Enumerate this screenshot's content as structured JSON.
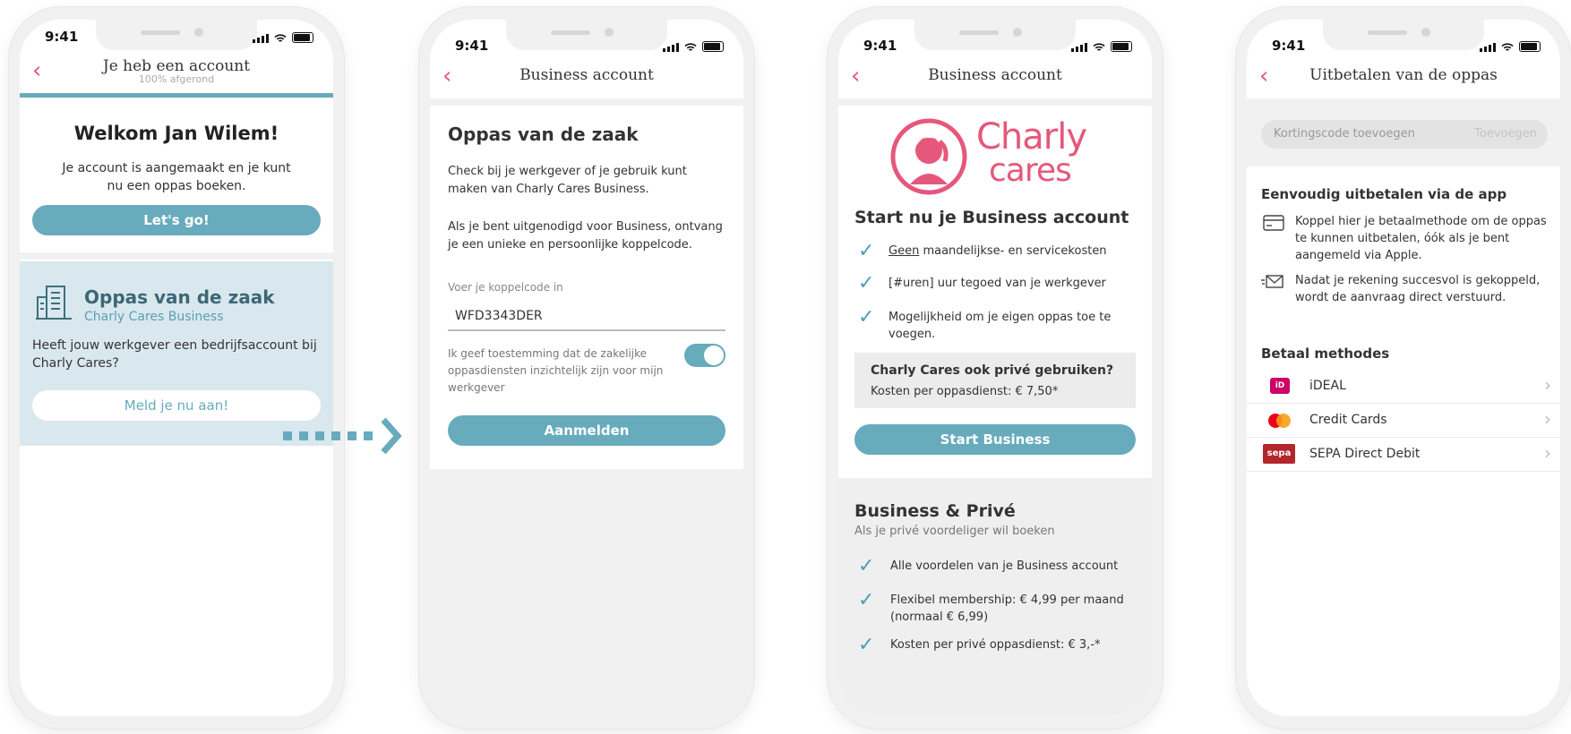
{
  "status_time": "9:41",
  "phone1": {
    "nav_title": "Je heb een account",
    "nav_subtitle": "100% afgerond",
    "welcome_title": "Welkom Jan Wilem!",
    "welcome_text": "Je account is aangemaakt en je kunt nu een oppas boeken.",
    "cta_label": "Let's go!",
    "business_title": "Oppas van de zaak",
    "business_subtitle": "Charly Cares Business",
    "business_text": "Heeft jouw werkgever een bedrijfsaccount bij Charly Cares?",
    "signup_label": "Meld je nu aan!"
  },
  "phone2": {
    "nav_title": "Business account",
    "heading": "Oppas van de zaak",
    "para1": "Check bij je werkgever of je gebruik kunt maken van Charly Cares Business.",
    "para2": "Als je bent uitgenodigd voor Business, ontvang je een unieke en persoonlijke koppelcode.",
    "field_label": "Voer je koppelcode in",
    "field_value": "WFD3343DER",
    "consent_text": "Ik geef toestemming dat de zakelijke oppasdiensten inzichtelijk zijn voor mijn werkgever",
    "toggle_on": true,
    "submit_label": "Aanmelden"
  },
  "phone3": {
    "nav_title": "Business account",
    "logo_line1": "Charly",
    "logo_line2": "cares",
    "start_title": "Start nu je Business account",
    "benefits": [
      {
        "prefix": "Geen",
        "rest": " maandelijkse- en servicekosten"
      },
      {
        "prefix": "",
        "rest": "[#uren] uur tegoed van je werkgever"
      },
      {
        "prefix": "",
        "rest": "Mogelijkheid om je eigen oppas toe te voegen."
      }
    ],
    "private_title": "Charly Cares ook privé gebruiken?",
    "private_cost": "Kosten per oppasdienst: € 7,50*",
    "start_button": "Start Business",
    "bp_title": "Business & Privé",
    "bp_subtitle": "Als je privé voordeliger wil boeken",
    "bp_benefits": [
      "Alle voordelen van je Business account",
      "Flexibel membership: € 4,99 per maand (normaal € 6,99)",
      "Kosten per privé oppasdienst: € 3,-*"
    ]
  },
  "phone4": {
    "nav_title": "Uitbetalen van de oppas",
    "discount_placeholder": "Kortingscode toevoegen",
    "discount_button": "Toevoegen",
    "section1_title": "Eenvoudig uitbetalen via de app",
    "info1": "Koppel hier je betaalmethode om de oppas te kunnen uitbetalen, óók als je bent aangemeld via Apple.",
    "info2": "Nadat je rekening succesvol is gekoppeld, wordt de aanvraag direct verstuurd.",
    "methods_title": "Betaal methodes",
    "methods": [
      "iDEAL",
      "Credit Cards",
      "SEPA Direct Debit"
    ],
    "icon_ideal": "iD",
    "icon_sepa": "sepa"
  },
  "colors": {
    "accent_teal": "#67abbd",
    "accent_pink": "#e5587b",
    "panel_blue": "#d9e8ee",
    "muted_grey": "#f1f1f1"
  }
}
